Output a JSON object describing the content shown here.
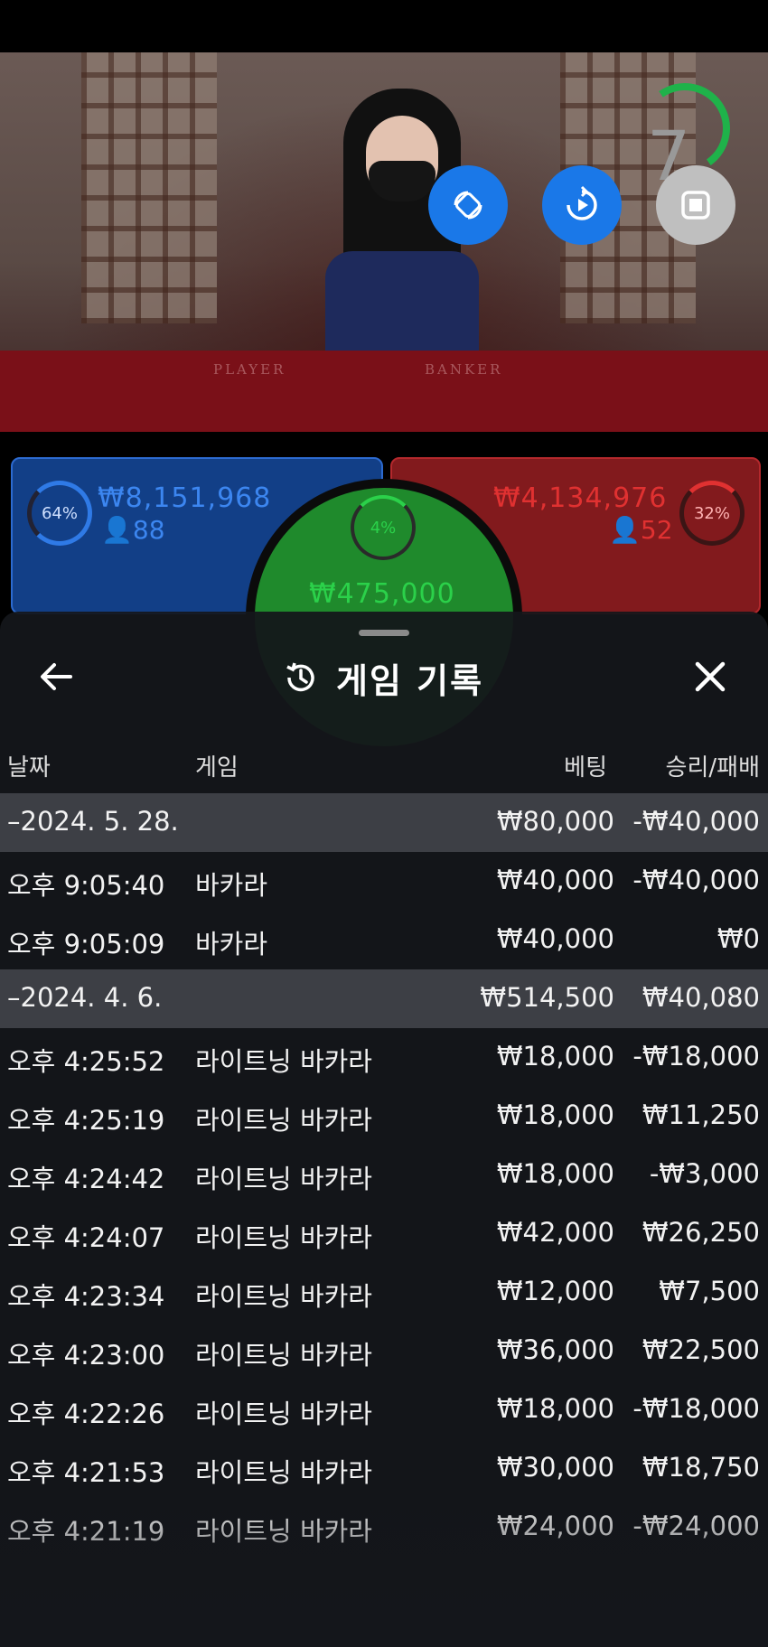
{
  "video": {
    "table_labels": [
      "PLAYER",
      "BANKER"
    ],
    "timer": "7"
  },
  "controls": {
    "icons": [
      "rotate-icon",
      "replay-icon",
      "stop-icon"
    ]
  },
  "bets": {
    "player": {
      "percent": "64%",
      "amount": "₩8,151,968",
      "count": "88",
      "color": "#2f7ae6"
    },
    "tie": {
      "percent": "4%",
      "amount": "₩475,000",
      "color": "#2bd14a"
    },
    "banker": {
      "percent": "32%",
      "amount": "₩4,134,976",
      "count": "52",
      "color": "#e03131"
    }
  },
  "history": {
    "title": "게임 기록",
    "columns": {
      "date": "날짜",
      "game": "게임",
      "bet": "베팅",
      "result": "승리/패배"
    },
    "rows": [
      {
        "type": "group",
        "date": "–2024. 5. 28.",
        "game": "",
        "bet": "₩80,000",
        "result": "-₩40,000"
      },
      {
        "type": "item",
        "date": "오후 9:05:40",
        "game": "바카라",
        "bet": "₩40,000",
        "result": "-₩40,000"
      },
      {
        "type": "item",
        "date": "오후 9:05:09",
        "game": "바카라",
        "bet": "₩40,000",
        "result": "₩0"
      },
      {
        "type": "group",
        "date": "–2024. 4. 6.",
        "game": "",
        "bet": "₩514,500",
        "result": "₩40,080"
      },
      {
        "type": "item",
        "date": "오후 4:25:52",
        "game": "라이트닝 바카라",
        "bet": "₩18,000",
        "result": "-₩18,000"
      },
      {
        "type": "item",
        "date": "오후 4:25:19",
        "game": "라이트닝 바카라",
        "bet": "₩18,000",
        "result": "₩11,250"
      },
      {
        "type": "item",
        "date": "오후 4:24:42",
        "game": "라이트닝 바카라",
        "bet": "₩18,000",
        "result": "-₩3,000"
      },
      {
        "type": "item",
        "date": "오후 4:24:07",
        "game": "라이트닝 바카라",
        "bet": "₩42,000",
        "result": "₩26,250"
      },
      {
        "type": "item",
        "date": "오후 4:23:34",
        "game": "라이트닝 바카라",
        "bet": "₩12,000",
        "result": "₩7,500"
      },
      {
        "type": "item",
        "date": "오후 4:23:00",
        "game": "라이트닝 바카라",
        "bet": "₩36,000",
        "result": "₩22,500"
      },
      {
        "type": "item",
        "date": "오후 4:22:26",
        "game": "라이트닝 바카라",
        "bet": "₩18,000",
        "result": "-₩18,000"
      },
      {
        "type": "item",
        "date": "오후 4:21:53",
        "game": "라이트닝 바카라",
        "bet": "₩30,000",
        "result": "₩18,750"
      },
      {
        "type": "item",
        "date": "오후 4:21:19",
        "game": "라이트닝 바카라",
        "bet": "₩24,000",
        "result": "-₩24,000"
      }
    ]
  }
}
